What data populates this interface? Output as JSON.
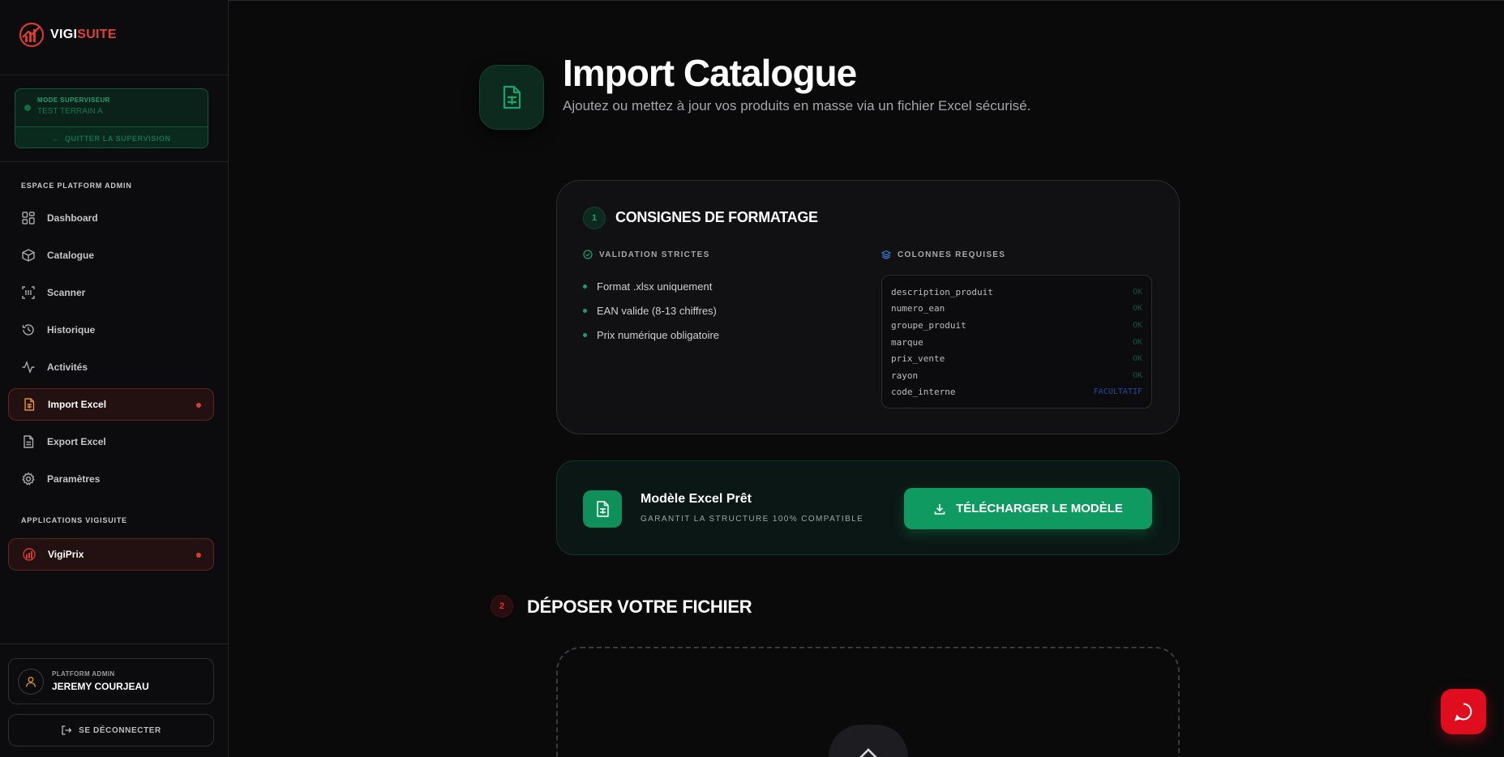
{
  "brand": {
    "part1": "VIGI",
    "part2": "SUITE"
  },
  "supervisor": {
    "label": "MODE SUPERVISEUR",
    "name": "TEST TERRAIN A",
    "quit": "QUITTER LA SUPERVISION"
  },
  "sidebar": {
    "section1": "ESPACE PLATFORM ADMIN",
    "items": [
      {
        "label": "Dashboard",
        "icon": "dashboard-icon"
      },
      {
        "label": "Catalogue",
        "icon": "box-icon"
      },
      {
        "label": "Scanner",
        "icon": "scan-icon"
      },
      {
        "label": "Historique",
        "icon": "history-icon"
      },
      {
        "label": "Activités",
        "icon": "activity-icon"
      },
      {
        "label": "Import Excel",
        "icon": "spreadsheet-icon",
        "active": true
      },
      {
        "label": "Export Excel",
        "icon": "document-icon"
      },
      {
        "label": "Paramètres",
        "icon": "gear-icon"
      }
    ],
    "section2": "APPLICATIONS VIGISUITE",
    "apps": [
      {
        "label": "VigiPrix"
      }
    ]
  },
  "user": {
    "role": "PLATFORM ADMIN",
    "name": "JEREMY COURJEAU"
  },
  "logout": "SE DÉCONNECTER",
  "header": {
    "title": "Import Catalogue",
    "subtitle": "Ajoutez ou mettez à jour vos produits en masse via un fichier Excel sécurisé."
  },
  "formatting": {
    "step": "1",
    "title": "CONSIGNES DE FORMATAGE",
    "validation_title": "VALIDATION STRICTES",
    "rules": [
      "Format .xlsx uniquement",
      "EAN valide (8-13 chiffres)",
      "Prix numérique obligatoire"
    ],
    "columns_title": "COLONNES REQUISES",
    "columns": [
      {
        "name": "description_produit",
        "status": "OK"
      },
      {
        "name": "numero_ean",
        "status": "OK"
      },
      {
        "name": "groupe_produit",
        "status": "OK"
      },
      {
        "name": "marque",
        "status": "OK"
      },
      {
        "name": "prix_vente",
        "status": "OK"
      },
      {
        "name": "rayon",
        "status": "OK"
      },
      {
        "name": "code_interne",
        "status": "FACULTATIF"
      }
    ]
  },
  "template": {
    "title": "Modèle Excel Prêt",
    "subtitle": "GARANTIT LA STRUCTURE 100% COMPATIBLE",
    "button": "TÉLÉCHARGER LE MODÈLE"
  },
  "drop": {
    "step": "2",
    "title": "DÉPOSER VOTRE FICHIER"
  },
  "colors": {
    "accent_green": "#0f9a62",
    "accent_red": "#e0402f",
    "chat_red": "#e00d1e"
  }
}
